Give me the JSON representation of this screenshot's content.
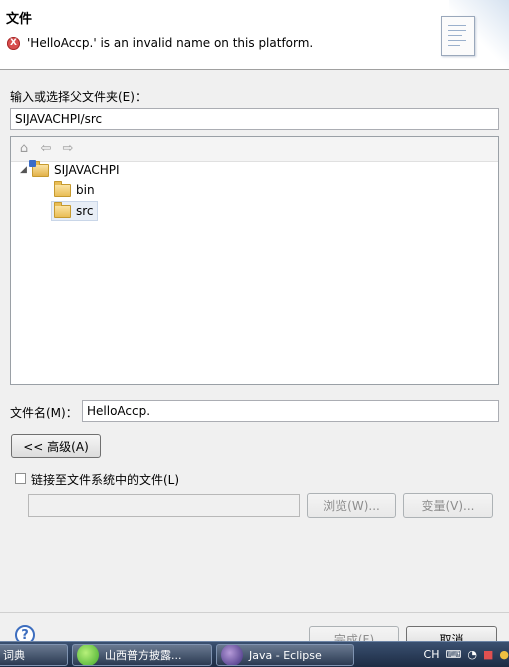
{
  "header": {
    "title": "文件",
    "error_symbol": "X",
    "error_message": "'HelloAccp.' is an invalid name on this platform."
  },
  "parent": {
    "label": "输入或选择父文件夹(E)：",
    "value": "SIJAVACHPI/src"
  },
  "tree": {
    "toolbar_icons": [
      "home-icon",
      "back-arrow-icon",
      "forward-arrow-icon"
    ],
    "nodes": [
      {
        "label": "SIJAVACHPI",
        "expanded": true
      },
      {
        "label": "bin"
      },
      {
        "label": "src",
        "selected": true
      }
    ]
  },
  "filename": {
    "label": "文件名(M)：",
    "value": "HelloAccp."
  },
  "advanced_button": "<< 高级(A)",
  "link": {
    "checkbox_label": "链接至文件系统中的文件(L)",
    "checked": false,
    "path_value": "",
    "browse_button": "浏览(W)...",
    "variables_button": "变量(V)..."
  },
  "footer": {
    "help_symbol": "?",
    "finish_button": "完成(F)",
    "cancel_button": "取消"
  },
  "taskbar": {
    "items": [
      {
        "label": "词典"
      },
      {
        "label": "山西普方披露..."
      },
      {
        "label": "Java - Eclipse"
      }
    ],
    "tray_text": "CH"
  },
  "colors": {
    "error": "#d84d4d",
    "folder": "#e9bd55",
    "help": "#3d6ebf",
    "taskbar": "#1d2c44"
  }
}
